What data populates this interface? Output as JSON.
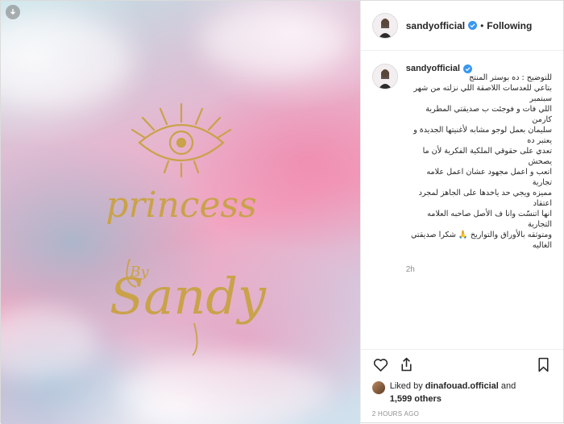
{
  "post": {
    "username": "sandyofficial",
    "follow_status": "Following",
    "separator": "•",
    "caption_username": "sandyofficial",
    "caption_lines": [
      "للتوضيح : ده بوستر المنتج",
      "بتاعي للعدسات اللاصقة اللي نزلته من شهر سبتمبر",
      "اللي فات و فوجئت ب صديقتي المطربة كارمن",
      "سليمان بعمل لوجو مشابه لأغنيتها الجديدة و يعتبر ده",
      "تعدي على حقوقي الملكية الفكرية لأن ما يصحش",
      "اتعب و اعمل مجهود عشان اعمل علامه تجارية",
      "مميزه ويجي حد ياخدها على الجاهز لمجرد اعتقاد",
      "انها اتنسّت وانا ف الأصل صاحبه العلامه التجارية",
      "ومتوثقه بالأوراق والتواريخ 🙏 شكرا صديقتي",
      "الغاليه"
    ],
    "time_ago": "2h",
    "likes": {
      "prefix": "Liked by",
      "liker": "dinafouad.official",
      "conj": "and",
      "others": "1,599 others"
    },
    "posted_ago": "2 HOURS AGO"
  },
  "artwork": {
    "line1": "princess",
    "by": "By",
    "line2": "Sandy",
    "gold": "#c9a24a"
  },
  "icons": {
    "download": "download-icon",
    "verified": "verified-badge-icon",
    "like": "heart-icon",
    "share": "share-icon",
    "save": "bookmark-icon"
  },
  "colors": {
    "verified": "#3897f0",
    "text": "#262626",
    "muted": "#8e8e8e"
  }
}
